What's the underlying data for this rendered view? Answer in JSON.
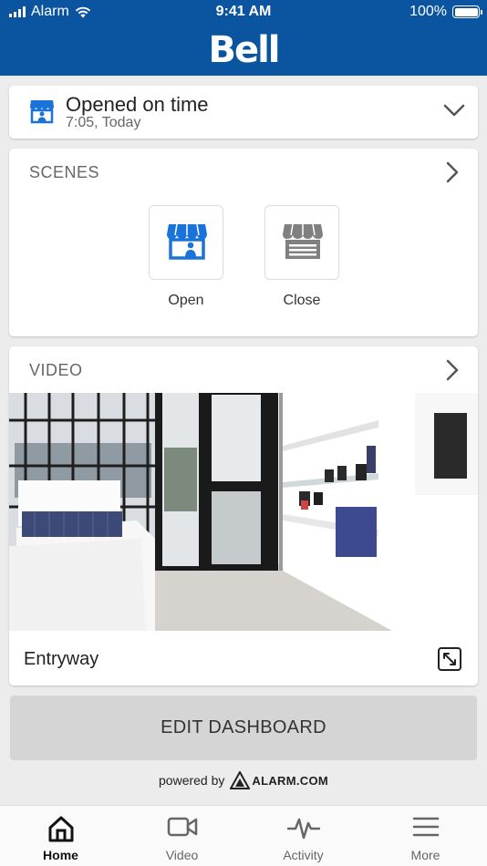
{
  "status_bar": {
    "carrier": "Alarm",
    "time": "9:41 AM",
    "battery": "100%"
  },
  "brand": {
    "logo_text": "Bell",
    "color": "#0b55a0"
  },
  "status_card": {
    "title": "Opened on time",
    "subtitle": "7:05, Today",
    "icon": "storefront-person-icon"
  },
  "scenes": {
    "title": "SCENES",
    "items": [
      {
        "label": "Open",
        "icon": "storefront-open-icon",
        "color": "#1a73d9"
      },
      {
        "label": "Close",
        "icon": "storefront-closed-icon",
        "color": "#808080"
      }
    ]
  },
  "video": {
    "title": "VIDEO",
    "camera_name": "Entryway"
  },
  "edit_dashboard": {
    "label": "EDIT DASHBOARD"
  },
  "footer": {
    "powered_by": "powered by",
    "partner": "ALARM.COM"
  },
  "tabs": [
    {
      "label": "Home",
      "icon": "home-icon",
      "active": true
    },
    {
      "label": "Video",
      "icon": "video-camera-icon",
      "active": false
    },
    {
      "label": "Activity",
      "icon": "activity-pulse-icon",
      "active": false
    },
    {
      "label": "More",
      "icon": "menu-icon",
      "active": false
    }
  ]
}
